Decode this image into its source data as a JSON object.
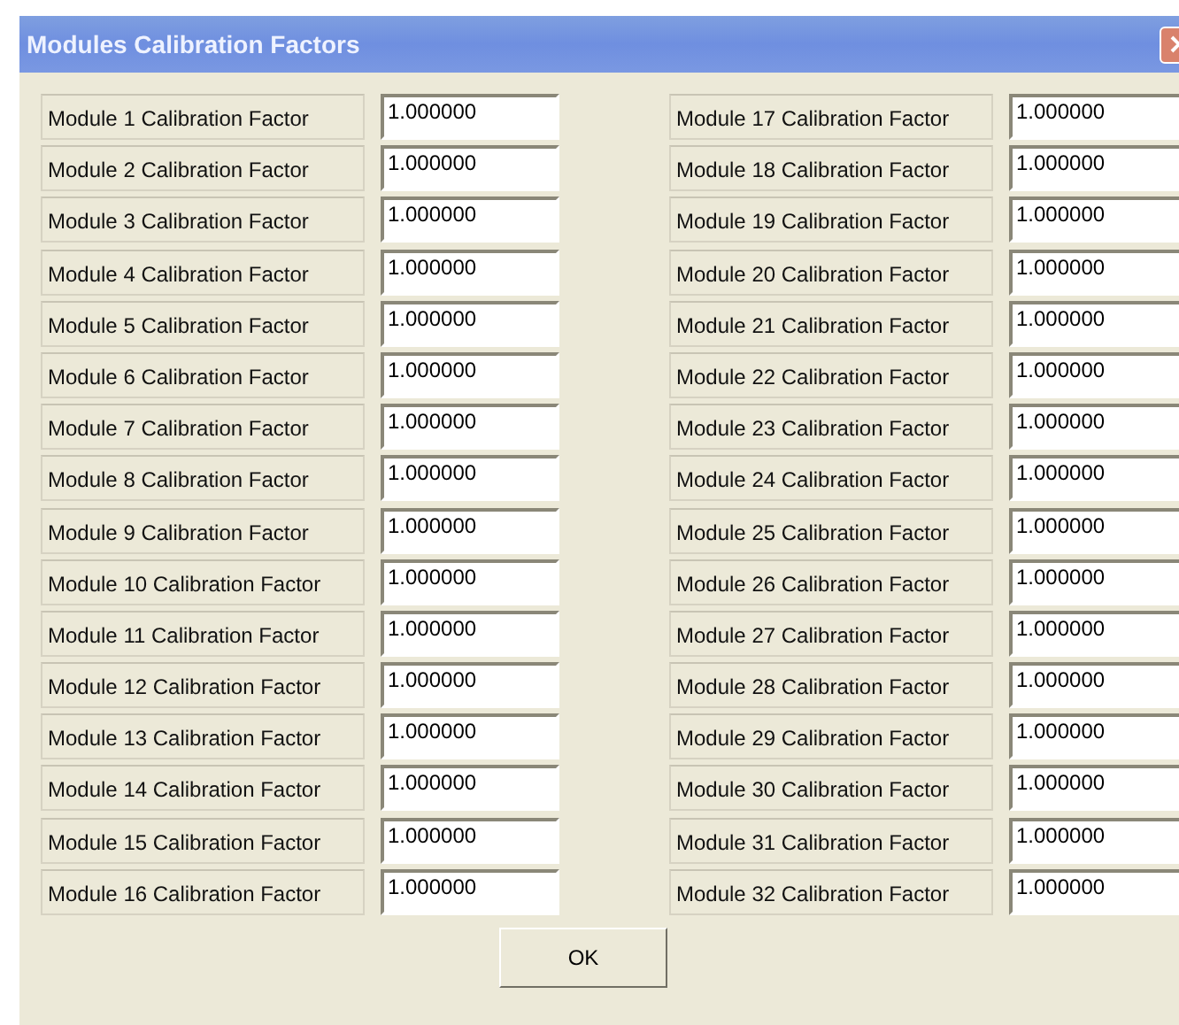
{
  "window": {
    "title": "Modules Calibration Factors"
  },
  "columns": [
    {
      "rows": [
        {
          "label": "Module 1 Calibration Factor",
          "value": "1.000000"
        },
        {
          "label": "Module 2 Calibration Factor",
          "value": "1.000000"
        },
        {
          "label": "Module 3 Calibration Factor",
          "value": "1.000000"
        },
        {
          "label": "Module 4 Calibration Factor",
          "value": "1.000000"
        },
        {
          "label": "Module 5 Calibration Factor",
          "value": "1.000000"
        },
        {
          "label": "Module 6 Calibration Factor",
          "value": "1.000000"
        },
        {
          "label": "Module 7 Calibration Factor",
          "value": "1.000000"
        },
        {
          "label": "Module 8 Calibration Factor",
          "value": "1.000000"
        },
        {
          "label": "Module 9 Calibration Factor",
          "value": "1.000000"
        },
        {
          "label": "Module 10 Calibration Factor",
          "value": "1.000000"
        },
        {
          "label": "Module 11 Calibration Factor",
          "value": "1.000000"
        },
        {
          "label": "Module 12 Calibration Factor",
          "value": "1.000000"
        },
        {
          "label": "Module 13 Calibration Factor",
          "value": "1.000000"
        },
        {
          "label": "Module 14 Calibration Factor",
          "value": "1.000000"
        },
        {
          "label": "Module 15 Calibration Factor",
          "value": "1.000000"
        },
        {
          "label": "Module 16 Calibration Factor",
          "value": "1.000000"
        }
      ]
    },
    {
      "rows": [
        {
          "label": "Module 17 Calibration Factor",
          "value": "1.000000"
        },
        {
          "label": "Module 18 Calibration Factor",
          "value": "1.000000"
        },
        {
          "label": "Module 19 Calibration Factor",
          "value": "1.000000"
        },
        {
          "label": "Module 20 Calibration Factor",
          "value": "1.000000"
        },
        {
          "label": "Module 21 Calibration Factor",
          "value": "1.000000"
        },
        {
          "label": "Module 22 Calibration Factor",
          "value": "1.000000"
        },
        {
          "label": "Module 23 Calibration Factor",
          "value": "1.000000"
        },
        {
          "label": "Module 24 Calibration Factor",
          "value": "1.000000"
        },
        {
          "label": "Module 25 Calibration Factor",
          "value": "1.000000"
        },
        {
          "label": "Module 26 Calibration Factor",
          "value": "1.000000"
        },
        {
          "label": "Module 27 Calibration Factor",
          "value": "1.000000"
        },
        {
          "label": "Module 28 Calibration Factor",
          "value": "1.000000"
        },
        {
          "label": "Module 29 Calibration Factor",
          "value": "1.000000"
        },
        {
          "label": "Module 30 Calibration Factor",
          "value": "1.000000"
        },
        {
          "label": "Module 31 Calibration Factor",
          "value": "1.000000"
        },
        {
          "label": "Module 32 Calibration Factor",
          "value": "1.000000"
        }
      ]
    }
  ],
  "buttons": [
    "OK"
  ]
}
